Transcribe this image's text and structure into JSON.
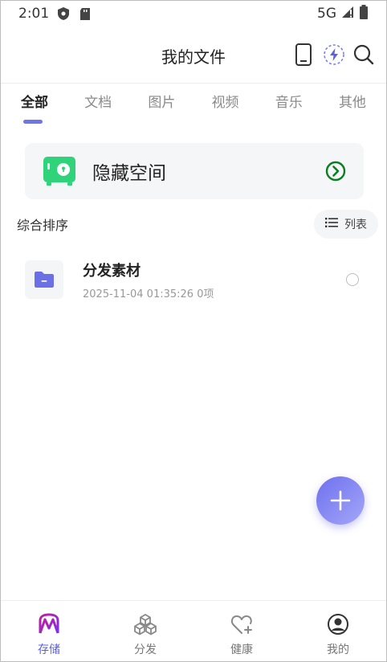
{
  "status_bar": {
    "time": "2:01",
    "network": "5G"
  },
  "header": {
    "title": "我的文件"
  },
  "tabs": [
    {
      "label": "全部",
      "active": true
    },
    {
      "label": "文档",
      "active": false
    },
    {
      "label": "图片",
      "active": false
    },
    {
      "label": "视频",
      "active": false
    },
    {
      "label": "音乐",
      "active": false
    },
    {
      "label": "其他",
      "active": false
    }
  ],
  "hidden_space": {
    "label": "隐藏空间"
  },
  "sort": {
    "label": "综合排序",
    "view_label": "列表"
  },
  "files": [
    {
      "name": "分发素材",
      "meta": "2025-11-04 01:35:26 0项"
    }
  ],
  "bottom_nav": [
    {
      "label": "存储",
      "icon": "storage-icon",
      "active": true
    },
    {
      "label": "分发",
      "icon": "cubes-icon",
      "active": false
    },
    {
      "label": "健康",
      "icon": "heart-plus-icon",
      "active": false
    },
    {
      "label": "我的",
      "icon": "user-circle-icon",
      "active": false
    }
  ],
  "colors": {
    "accent": "#6f74e8",
    "safe_green": "#2fd37a",
    "arrow_green": "#0a7d1e"
  }
}
